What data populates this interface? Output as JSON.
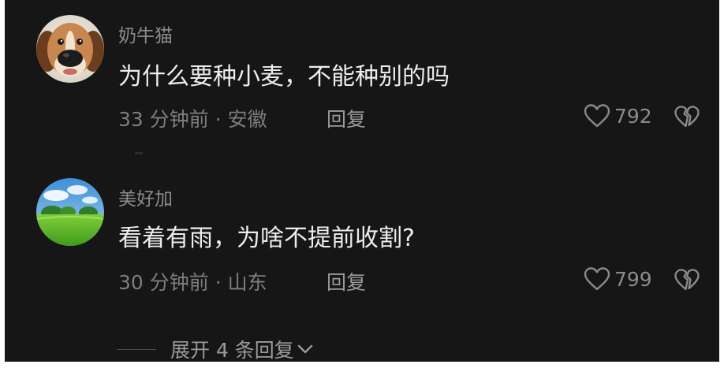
{
  "comments": [
    {
      "username": "奶牛猫",
      "content": "为什么要种小麦，不能种别的吗",
      "meta": "33 分钟前 · 安徽",
      "reply_label": "回复",
      "likes": "792",
      "avatar_icon": "dog-avatar-icon"
    },
    {
      "username": "美好加",
      "content": "看着有雨，为啥不提前收割?",
      "meta": "30 分钟前 · 山东",
      "reply_label": "回复",
      "likes": "799",
      "avatar_icon": "landscape-avatar-icon"
    }
  ],
  "expand": {
    "label": "展开 4 条回复"
  },
  "colors": {
    "background": "#161616",
    "username": "#8b8b8b",
    "content": "#ededed",
    "meta": "#7d7d7d"
  }
}
